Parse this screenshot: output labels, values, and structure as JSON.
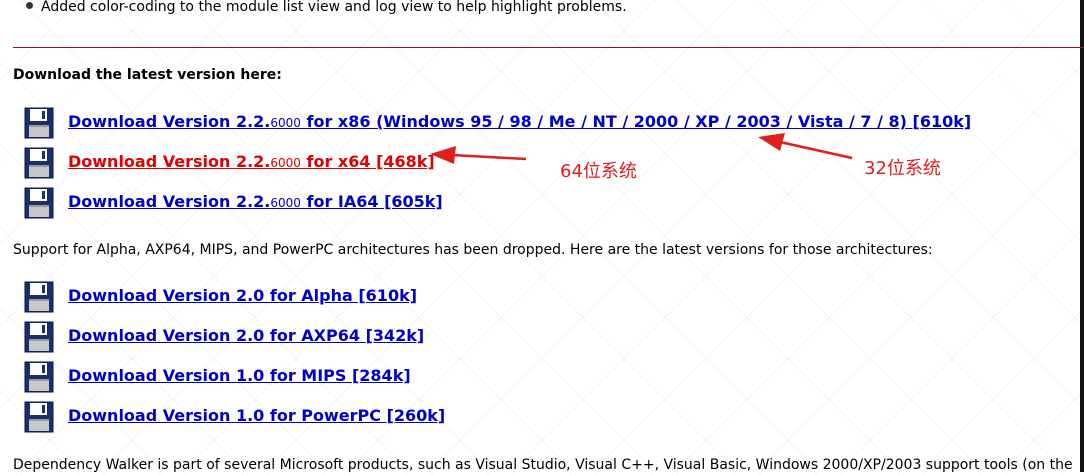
{
  "bullet_text": "Added color-coding to the module list view and log view to help highlight problems.",
  "section_heading": "Download the latest version here:",
  "latest_downloads": [
    {
      "prefix": "Download Version 2.2.",
      "build": "6000",
      "suffix": " for x86 (Windows 95 / 98 / Me / NT / 2000 / XP / 2003 / Vista / 7 / 8) [610k]"
    },
    {
      "prefix": "Download Version 2.2.",
      "build": "6000",
      "suffix": " for x64 [468k]"
    },
    {
      "prefix": "Download Version 2.2.",
      "build": "6000",
      "suffix": " for IA64 [605k]"
    }
  ],
  "support_text": "Support for Alpha, AXP64, MIPS, and PowerPC architectures has been dropped.  Here are the latest versions for those architectures:",
  "legacy_downloads": [
    {
      "label": "Download Version 2.0 for Alpha [610k]"
    },
    {
      "label": "Download Version 2.0 for AXP64 [342k]"
    },
    {
      "label": "Download Version 1.0 for MIPS [284k]"
    },
    {
      "label": "Download Version 1.0 for PowerPC [260k]"
    }
  ],
  "footer_text": "Dependency Walker is part of several Microsoft products, such as Visual Studio, Visual C++, Visual Basic, Windows 2000/XP/2003 support tools (on the",
  "annotations": {
    "x64_label": "64位系统",
    "x86_label": "32位系统",
    "color": "#e0201c"
  },
  "colors": {
    "link": "#0000cc",
    "active_link": "#e00000",
    "divider": "#a0101e"
  },
  "icons": {
    "download": "floppy-disk-icon",
    "bullet": "bullet-icon"
  }
}
